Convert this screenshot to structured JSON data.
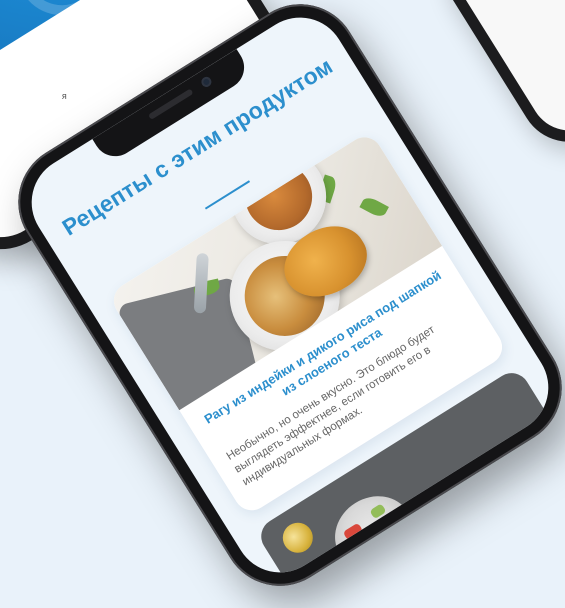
{
  "background_color": "#e9f2fa",
  "accent_color": "#2c8fcd",
  "background_phone": {
    "partial_text": "я"
  },
  "main_phone": {
    "section_title": "Рецепты с этим продуктом",
    "recipe_card": {
      "title": "Рагу из индейки и дикого риса под шапкой из слоеного теста",
      "description": "Необычно, но очень вкусно. Это блюдо будет выглядеть эффектнее, если готовить его в индивидуальных формах."
    },
    "second_card": {
      "image": "salad-photo"
    }
  }
}
